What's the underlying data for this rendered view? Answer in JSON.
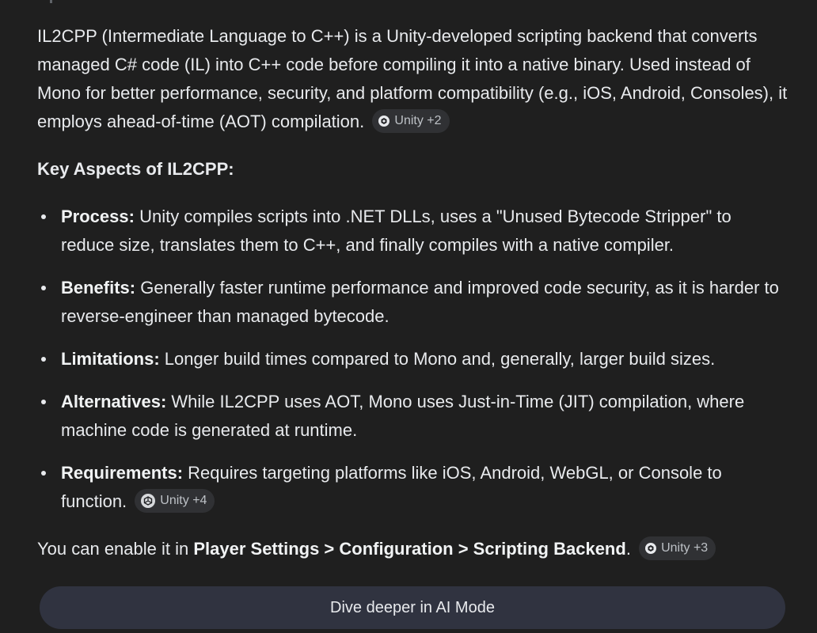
{
  "intro": {
    "text": "IL2CPP (Intermediate Language to C++) is a Unity-developed scripting backend that converts managed C# code (IL) into C++ code before compiling it into a native binary. Used instead of Mono for better performance, security, and platform compatibility (e.g., iOS, Android, Consoles), it employs ahead-of-time (AOT) compilation.",
    "source_chip": "Unity +2"
  },
  "heading": "Key Aspects of IL2CPP:",
  "bullets": [
    {
      "label": "Process:",
      "text": "Unity compiles scripts into .NET DLLs, uses a \"Unused Bytecode Stripper\" to reduce size, translates them to C++, and finally compiles with a native compiler."
    },
    {
      "label": "Benefits:",
      "text": "Generally faster runtime performance and improved code security, as it is harder to reverse-engineer than managed bytecode."
    },
    {
      "label": "Limitations:",
      "text": "Longer build times compared to Mono and, generally, larger build sizes."
    },
    {
      "label": "Alternatives:",
      "text": "While IL2CPP uses AOT, Mono uses Just-in-Time (JIT) compilation, where machine code is generated at runtime."
    },
    {
      "label": "Requirements:",
      "text": "Requires targeting platforms like iOS, Android, WebGL, or Console to function.",
      "source_chip": "Unity +4"
    }
  ],
  "closing": {
    "prefix": "You can enable it in",
    "path": "Player Settings > Configuration > Scripting Backend",
    "suffix": ".",
    "source_chip": "Unity +3"
  },
  "dive_button": "Dive deeper in AI Mode",
  "icons": {
    "chip_icon": "unity-logo-icon"
  },
  "colors": {
    "background": "#1f1f1f",
    "text": "#e8eaed",
    "chip_background": "#303134",
    "button_background": "#303340"
  }
}
